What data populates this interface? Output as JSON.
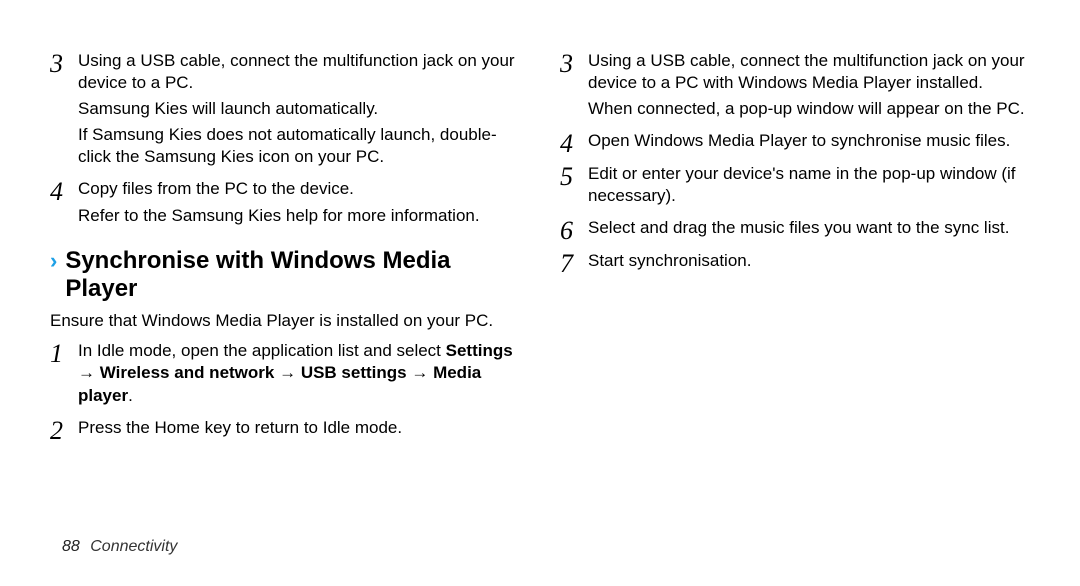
{
  "left": {
    "step3": {
      "num": "3",
      "line1": "Using a USB cable, connect the multifunction jack on your device to a PC.",
      "line2": "Samsung Kies will launch automatically.",
      "line3": "If Samsung Kies does not automatically launch, double-click the Samsung Kies icon on your PC."
    },
    "step4": {
      "num": "4",
      "line1": "Copy files from the PC to the device.",
      "line2": "Refer to the Samsung Kies help for more information."
    },
    "heading": "Synchronise with Windows Media Player",
    "intro": "Ensure that Windows Media Player is installed on your PC.",
    "step1b": {
      "num": "1",
      "line1": "In Idle mode, open the application list and select ",
      "bold1": "Settings",
      "arrow1": " → ",
      "bold2": "Wireless and network",
      "arrow2": " → ",
      "bold3": "USB settings",
      "arrow3": " → ",
      "bold4": "Media player",
      "period": "."
    },
    "step2b": {
      "num": "2",
      "line1": "Press the Home key to return to Idle mode."
    }
  },
  "right": {
    "step3": {
      "num": "3",
      "line1": "Using a USB cable, connect the multifunction jack on your device to a PC with Windows Media Player installed.",
      "line2": "When connected, a pop-up window will appear on the PC."
    },
    "step4": {
      "num": "4",
      "line1": "Open Windows Media Player to synchronise music files."
    },
    "step5": {
      "num": "5",
      "line1": "Edit or enter your device's name in the pop-up window (if necessary)."
    },
    "step6": {
      "num": "6",
      "line1": "Select and drag the music files you want to the sync list."
    },
    "step7": {
      "num": "7",
      "line1": "Start synchronisation."
    }
  },
  "footer": {
    "page": "88",
    "section": "Connectivity"
  }
}
